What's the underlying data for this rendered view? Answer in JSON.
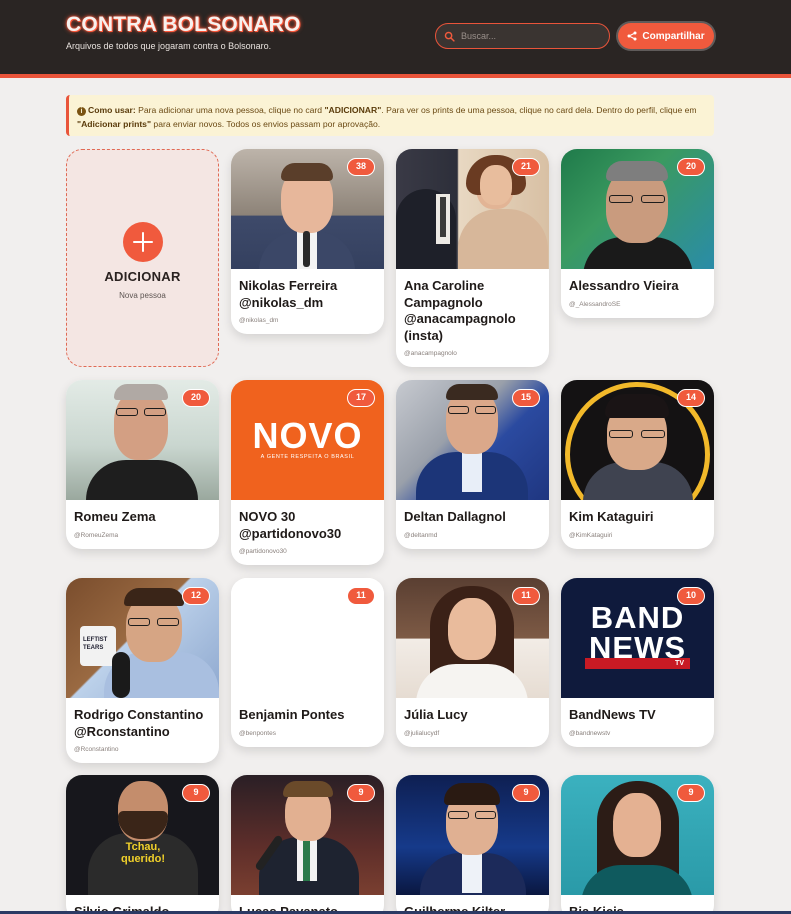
{
  "header": {
    "title": "CONTRA BOLSONARO",
    "subtitle": "Arquivos de todos que jogaram contra o Bolsonaro.",
    "search_placeholder": "Buscar...",
    "share_label": "Compartilhar"
  },
  "info": {
    "icon": "info-icon",
    "lead": "Como usar:",
    "text1": " Para adicionar uma nova pessoa, clique no card ",
    "add_word": "\"ADICIONAR\"",
    "text2": ". Para ver os prints de uma pessoa, clique no card dela. Dentro do perfil, clique em ",
    "prints_word": "\"Adicionar prints\"",
    "text3": " para enviar novos. Todos os envios passam por aprovação."
  },
  "add_card": {
    "label": "ADICIONAR",
    "sub": "Nova pessoa"
  },
  "people": [
    {
      "name": "Nikolas Ferreira @nikolas_dm",
      "handle": "@nikolas_dm",
      "count": "38"
    },
    {
      "name": "Ana Caroline Campagnolo @anacampagnolo (insta)",
      "handle": "@anacampagnolo",
      "count": "21"
    },
    {
      "name": "Alessandro Vieira",
      "handle": "@_AlessandroSE",
      "count": "20"
    },
    {
      "name": "Romeu Zema",
      "handle": "@RomeuZema",
      "count": "20"
    },
    {
      "name": "NOVO 30 @partidonovo30",
      "handle": "@partidonovo30",
      "count": "17"
    },
    {
      "name": "Deltan Dallagnol",
      "handle": "@deltanmd",
      "count": "15"
    },
    {
      "name": "Kim Kataguiri",
      "handle": "@KimKataguiri",
      "count": "14"
    },
    {
      "name": "Rodrigo Constantino @Rconstantino",
      "handle": "@Rconstantino",
      "count": "12"
    },
    {
      "name": "Benjamin Pontes",
      "handle": "@benpontes",
      "count": "11"
    },
    {
      "name": "Júlia Lucy",
      "handle": "@julialucydf",
      "count": "11"
    },
    {
      "name": "BandNews TV",
      "handle": "@bandnewstv",
      "count": "10"
    },
    {
      "name": "Silvio Grimaldo",
      "handle": "",
      "count": "9"
    },
    {
      "name": "Lucas Pavanato",
      "handle": "",
      "count": "9"
    },
    {
      "name": "Guilherme Kilter",
      "handle": "",
      "count": "9"
    },
    {
      "name": "Bia Kicis",
      "handle": "",
      "count": "9"
    }
  ],
  "photo_text": {
    "novo_logo": "NOVO",
    "novo_slogan": "A GENTE RESPEITA O BRASIL",
    "band_line1": "BAND",
    "band_line2": "NEWS",
    "band_tv": "TV",
    "shirt_text": "Tchau, querido!",
    "mug_text": "LEFTIST TEARS"
  },
  "colors": {
    "accent": "#f05a3d",
    "header_bg": "#2a2523",
    "page_bg": "#f1efee",
    "info_bg": "#fbf3d5"
  }
}
